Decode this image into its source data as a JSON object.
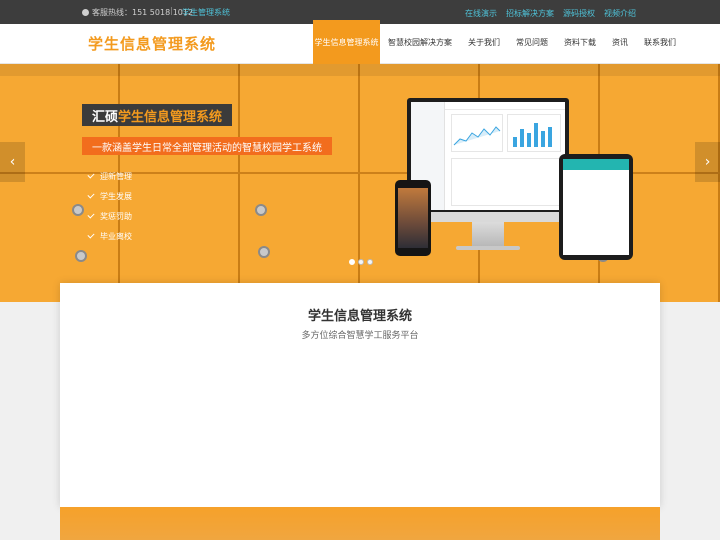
{
  "topbar": {
    "phone_label": "客服热线：151 5018 1012",
    "separator": "|",
    "system_link": "学生管理系统",
    "right_links": [
      "在线演示",
      "招标解决方案",
      "源码授权",
      "视频介绍"
    ]
  },
  "header": {
    "logo": "学生信息管理系统",
    "nav": [
      {
        "label": "学生信息管理系统",
        "active": true
      },
      {
        "label": "智慧校园解决方案",
        "active": false
      },
      {
        "label": "关于我们",
        "active": false
      },
      {
        "label": "常见问题",
        "active": false
      },
      {
        "label": "资料下载",
        "active": false
      },
      {
        "label": "资讯",
        "active": false
      },
      {
        "label": "联系我们",
        "active": false
      }
    ]
  },
  "hero": {
    "title_white": "汇硕",
    "title_orange": "学生信息管理系统",
    "subtitle": "一款涵盖学生日常全部管理活动的智慧校园学工系统",
    "features": [
      "迎新管理",
      "学生发展",
      "奖惩罚助",
      "毕业离校"
    ],
    "prev_arrow": "‹",
    "next_arrow": "›",
    "slide_count": 3,
    "active_slide": 0
  },
  "section": {
    "title": "学生信息管理系统",
    "subtitle": "多方位综合智慧学工服务平台"
  },
  "colors": {
    "accent": "#f39a1e",
    "topbar_bg": "#3d3d3d",
    "link_cyan": "#4fc3d9",
    "subtitle_bg": "#f26d1d"
  }
}
